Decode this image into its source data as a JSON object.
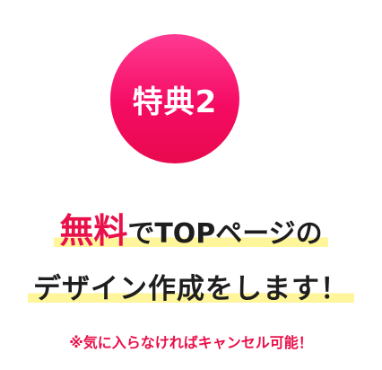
{
  "badge": {
    "label": "特典2"
  },
  "headline": {
    "emphasis": "無料",
    "line1_rest": "でTOPページの",
    "line2": "デザイン作成をします！"
  },
  "note": "※気に入らなければキャンセル可能！",
  "colors": {
    "accent": "#e8114a",
    "highlight": "#fff59a",
    "text": "#1e1e1e"
  }
}
